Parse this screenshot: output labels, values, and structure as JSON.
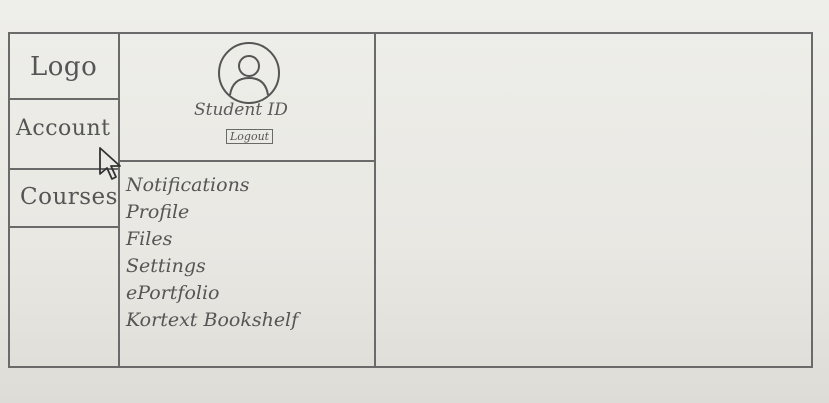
{
  "nav": {
    "logo": "Logo",
    "account": "Account",
    "courses": "Courses"
  },
  "profile": {
    "student_id": "Student ID",
    "logout": "Logout"
  },
  "menu": {
    "items": [
      "Notifications",
      "Profile",
      "Files",
      "Settings",
      "ePortfolio",
      "Kortext Bookshelf"
    ]
  },
  "icons": {
    "avatar": "user-icon",
    "cursor": "pointer-cursor-icon"
  }
}
